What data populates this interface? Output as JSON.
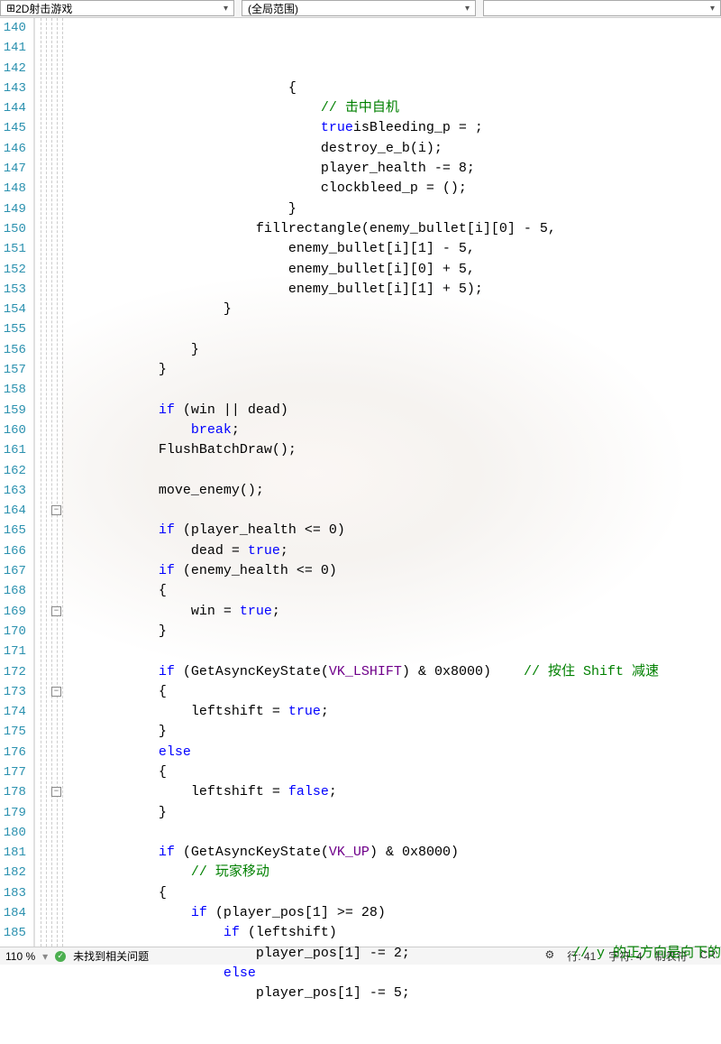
{
  "toolbar": {
    "dropdown1": "2D射击游戏",
    "dropdown2": "(全局范围)"
  },
  "lines": {
    "start": 140,
    "end": 185
  },
  "code": {
    "l140": {
      "indent": "                            ",
      "text": "{"
    },
    "l141": {
      "indent": "                                ",
      "comment": "// 击中自机"
    },
    "l142": {
      "indent": "                                ",
      "var1": "isBleeding_p",
      "op": " = ",
      "kw": "true",
      "end": ";"
    },
    "l143": {
      "indent": "                                ",
      "fn": "destroy_e_b",
      "args": "(i);"
    },
    "l144": {
      "indent": "                                ",
      "var1": "player_health",
      "op": " -= ",
      "val": "8",
      "end": ";"
    },
    "l145": {
      "indent": "                                ",
      "var1": "bleed_p",
      "op": " = ",
      "fn": "clock",
      "end": "();"
    },
    "l146": {
      "indent": "                            ",
      "text": "}"
    },
    "l147": {
      "indent": "                        ",
      "fn": "fillrectangle",
      "args": "(enemy_bullet[i][0] - 5,"
    },
    "l148": {
      "indent": "                            ",
      "args": "enemy_bullet[i][1] - 5,"
    },
    "l149": {
      "indent": "                            ",
      "args": "enemy_bullet[i][0] + 5,"
    },
    "l150": {
      "indent": "                            ",
      "args": "enemy_bullet[i][1] + 5);"
    },
    "l151": {
      "indent": "                    ",
      "text": "}"
    },
    "l152": {
      "indent": "",
      "text": ""
    },
    "l153": {
      "indent": "                ",
      "text": "}"
    },
    "l154": {
      "indent": "            ",
      "text": "}"
    },
    "l155": {
      "indent": "",
      "text": ""
    },
    "l156": {
      "indent": "            ",
      "kw": "if",
      "cond": " (win || dead)"
    },
    "l157": {
      "indent": "                ",
      "kw": "break",
      "end": ";"
    },
    "l158": {
      "indent": "            ",
      "fn": "FlushBatchDraw",
      "end": "();"
    },
    "l159": {
      "indent": "",
      "text": ""
    },
    "l160": {
      "indent": "            ",
      "fn": "move_enemy",
      "end": "();"
    },
    "l161": {
      "indent": "",
      "text": ""
    },
    "l162": {
      "indent": "            ",
      "kw": "if",
      "cond": " (player_health <= 0)"
    },
    "l163": {
      "indent": "                ",
      "var1": "dead",
      "op": " = ",
      "kw2": "true",
      "end": ";"
    },
    "l164": {
      "indent": "            ",
      "kw": "if",
      "cond": " (enemy_health <= 0)"
    },
    "l165": {
      "indent": "            ",
      "text": "{"
    },
    "l166": {
      "indent": "                ",
      "var1": "win",
      "op": " = ",
      "kw2": "true",
      "end": ";"
    },
    "l167": {
      "indent": "            ",
      "text": "}"
    },
    "l168": {
      "indent": "",
      "text": ""
    },
    "l169": {
      "indent": "            ",
      "kw": "if",
      "pre": " (",
      "fn": "GetAsyncKeyState",
      "args": "(",
      "macro": "VK_LSHIFT",
      "post": ") & 0x8000)    ",
      "comment": "// 按住 Shift 减速"
    },
    "l170": {
      "indent": "            ",
      "text": "{"
    },
    "l171": {
      "indent": "                ",
      "var1": "leftshift",
      "op": " = ",
      "kw2": "true",
      "end": ";"
    },
    "l172": {
      "indent": "            ",
      "text": "}"
    },
    "l173": {
      "indent": "            ",
      "kw": "else"
    },
    "l174": {
      "indent": "            ",
      "text": "{"
    },
    "l175": {
      "indent": "                ",
      "var1": "leftshift",
      "op": " = ",
      "kw2": "false",
      "end": ";"
    },
    "l176": {
      "indent": "            ",
      "text": "}"
    },
    "l177": {
      "indent": "",
      "text": ""
    },
    "l178": {
      "indent": "            ",
      "kw": "if",
      "pre": " (",
      "fn": "GetAsyncKeyState",
      "args": "(",
      "macro": "VK_UP",
      "post": ") & 0x8000)"
    },
    "l179": {
      "indent": "                ",
      "comment": "// 玩家移动"
    },
    "l180": {
      "indent": "            ",
      "text": "{"
    },
    "l181": {
      "indent": "                ",
      "kw": "if",
      "cond": " (player_pos[1] >= 28)"
    },
    "l182": {
      "indent": "                    ",
      "kw": "if",
      "cond": " (leftshift)"
    },
    "l183": {
      "indent": "                        ",
      "var1": "player_pos[1]",
      "op": " -= ",
      "val": "2",
      "end": ";",
      "comment": "                    // y 的正方向是向下的"
    },
    "l184": {
      "indent": "                    ",
      "kw": "else"
    },
    "l185": {
      "indent": "                        ",
      "var1": "player_pos[1]",
      "op": " -= ",
      "val": "5",
      "end": ";"
    }
  },
  "fold_markers": [
    164,
    169,
    173,
    178
  ],
  "status": {
    "zoom": "110 %",
    "problems": "未找到相关问题",
    "line_col": "行: 41",
    "char": "字符: 4",
    "tabs": "制表符"
  }
}
